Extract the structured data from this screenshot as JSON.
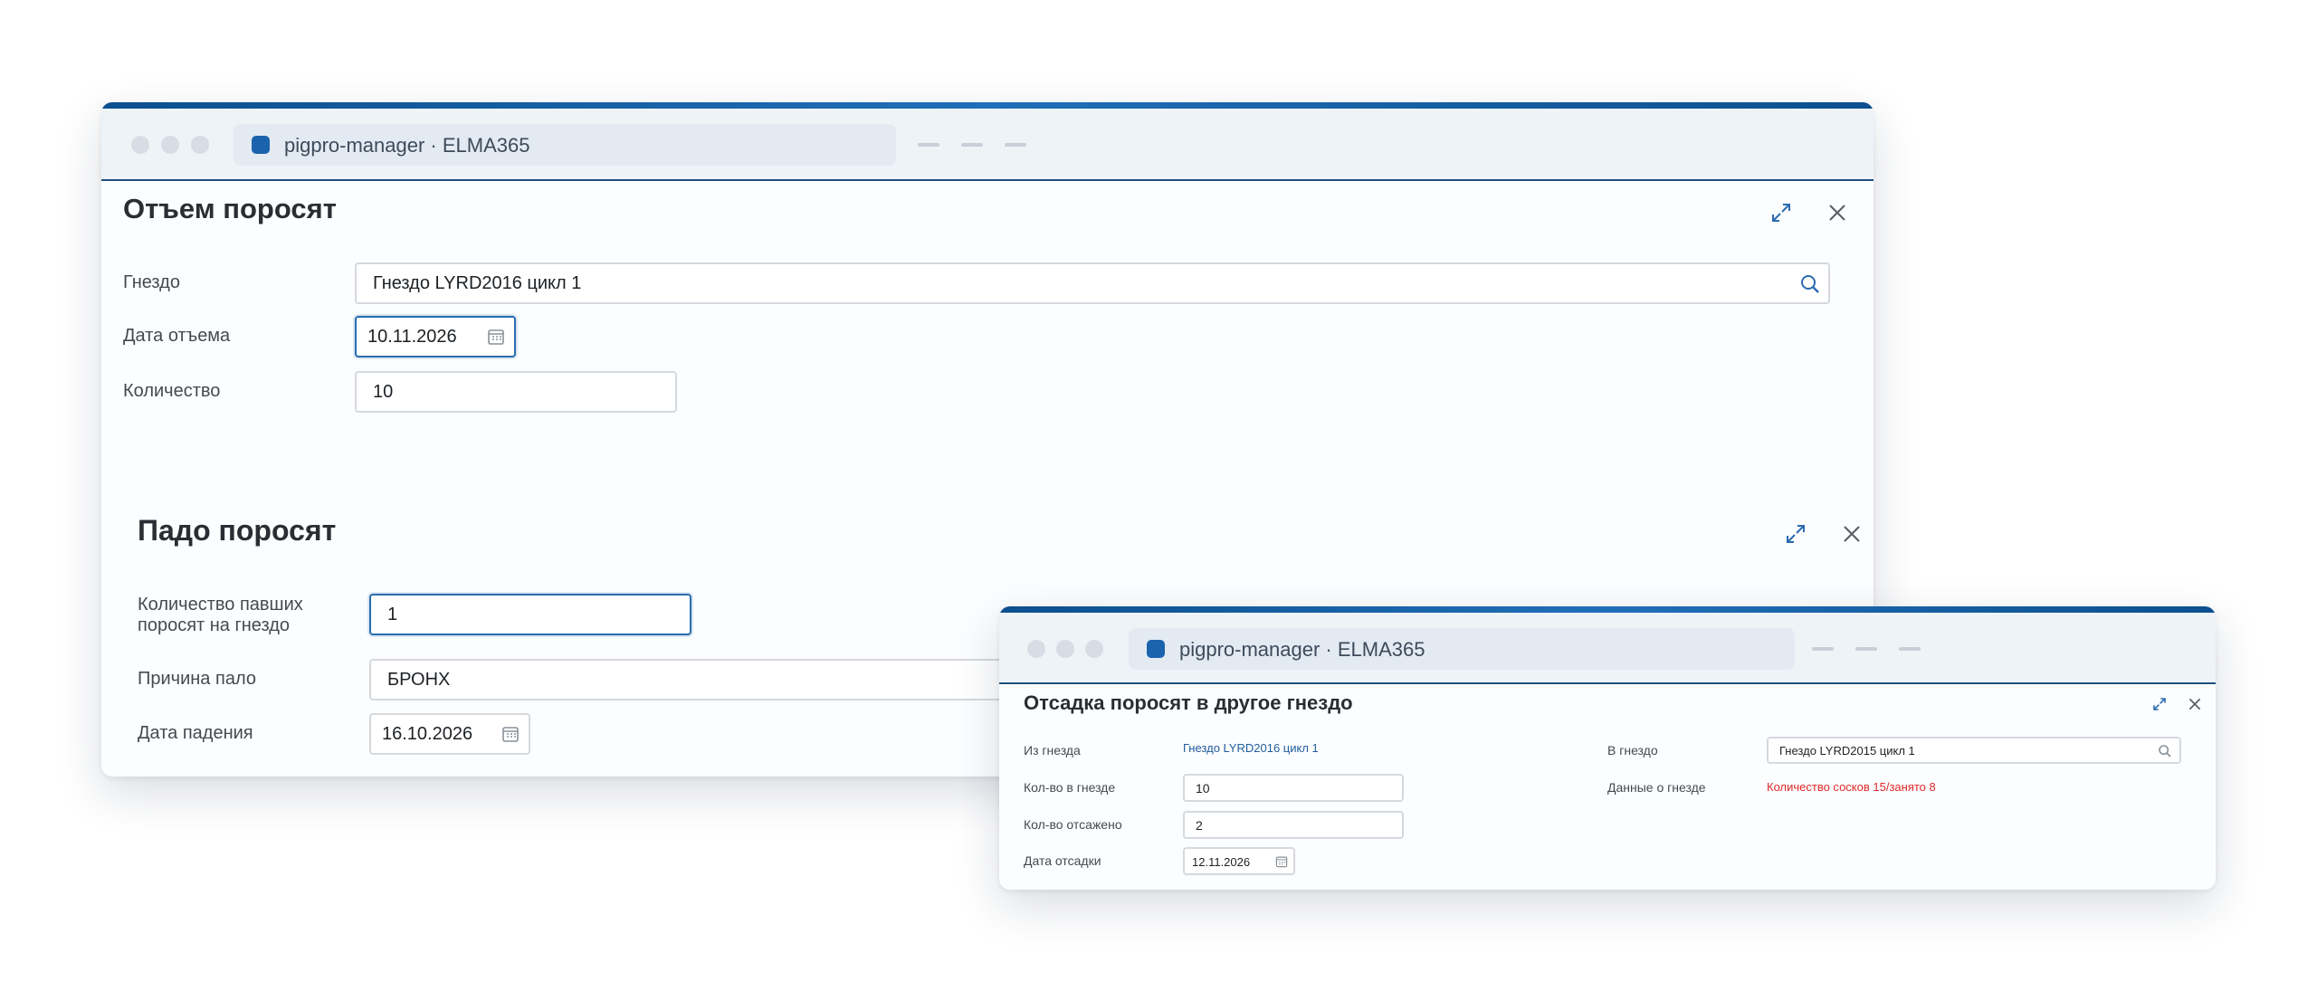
{
  "windows": {
    "main": {
      "tab_title": "pigpro-manager · ELMA365",
      "weaning": {
        "title": "Отъем поросят",
        "nest_label": "Гнездо",
        "nest_value": "Гнездо LYRD2016  цикл 1",
        "date_label": "Дата отъема",
        "date_value": "10.11.2026",
        "qty_label": "Количество",
        "qty_value": "10"
      },
      "death": {
        "title": "Падо поросят",
        "count_label_1": "Количество павших",
        "count_label_2": "поросят на гнездо",
        "count_value": "1",
        "reason_label": "Причина пало",
        "reason_value": "БРОНХ",
        "date_label": "Дата падения",
        "date_value": "16.10.2026"
      }
    },
    "second": {
      "tab_title": "pigpro-manager · ELMA365",
      "transfer": {
        "title": "Отсадка поросят в другое гнездо",
        "from_label": "Из гнезда",
        "from_value": "Гнездо LYRD2016 цикл 1",
        "count_label": "Кол-во в гнезде",
        "count_value": "10",
        "moved_label": "Кол-во отсажено",
        "moved_value": "2",
        "date_label": "Дата отсадки",
        "date_value": "12.11.2026",
        "to_label": "В гнездо",
        "to_value": "Гнездо LYRD2015  цикл 1",
        "info_label": "Данные о гнезде",
        "info_value": "Количество сосков 15/занято 8"
      }
    }
  },
  "colors": {
    "accent": "#1b63ad",
    "warning": "#e02a2a",
    "link": "#1f5d9c"
  },
  "icons": [
    "search-icon",
    "calendar-icon",
    "expand-icon",
    "close-icon"
  ]
}
